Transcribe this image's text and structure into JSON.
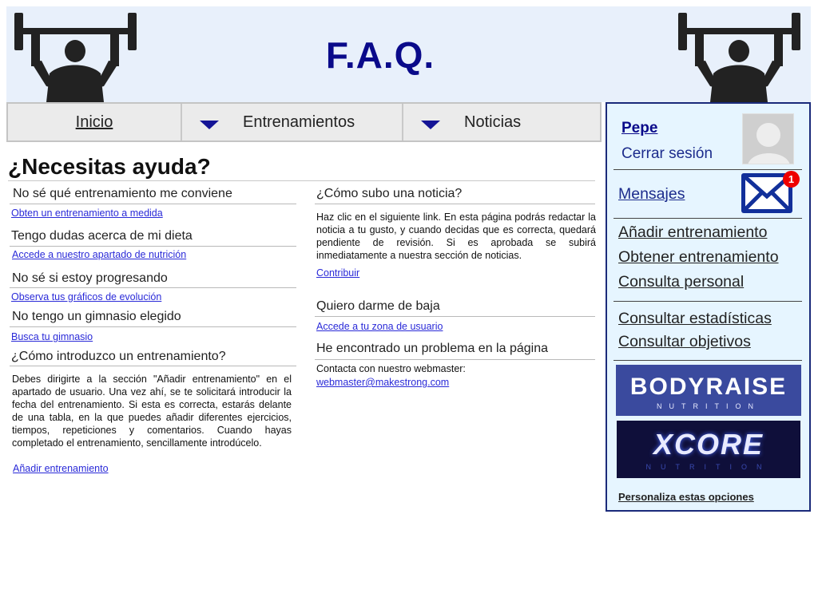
{
  "header": {
    "title": "F.A.Q."
  },
  "nav": {
    "home": "Inicio",
    "training": "Entrenamientos",
    "news": "Noticias"
  },
  "main": {
    "title": "¿Necesitas ayuda?",
    "left": [
      {
        "q": "No sé qué entrenamiento me conviene",
        "link": "Obten un entrenamiento a medida"
      },
      {
        "q": "Tengo dudas acerca de mi dieta",
        "link": "Accede a nuestro apartado de nutrición"
      },
      {
        "q": "No sé si estoy progresando",
        "link": "Observa tus gráficos de evolución"
      },
      {
        "q": "No tengo un gimnasio elegido",
        "link": "Busca tu gimnasio"
      },
      {
        "q": "¿Cómo introduzco un entrenamiento?",
        "text": "Debes dirigirte a la sección \"Añadir entrenamiento\" en el apartado de usuario. Una vez ahí, se te solicitará introducir la fecha del entrenamiento. Si esta es correcta, estarás delante de una tabla, en la que puedes añadir diferentes ejercicios, tiempos, repeticiones y comentarios. Cuando hayas completado el entrenamiento, sencillamente introdúcelo.",
        "link": "Añadir entrenamiento"
      }
    ],
    "right": [
      {
        "q": "¿Cómo subo una noticia?",
        "text": "Haz clic en el siguiente link. En esta página podrás redactar la noticia a tu gusto, y cuando decidas que es correcta, quedará pendiente de revisión. Si es aprobada se subirá inmediatamente a nuestra sección de noticias.",
        "link": "Contribuir"
      },
      {
        "q": "Quiero darme de baja",
        "link": "Accede a tu zona de usuario"
      },
      {
        "q": "He encontrado un problema en la página",
        "text": "Contacta con nuestro webmaster:",
        "link": "webmaster@makestrong.com"
      }
    ]
  },
  "sidebar": {
    "user": "Pepe",
    "logout": "Cerrar sesión",
    "messages": "Mensajes",
    "unread": "1",
    "links": [
      "Añadir entrenamiento",
      "Obtener entrenamiento",
      "Consulta personal",
      "Consultar estadísticas",
      "Consultar objetivos"
    ],
    "banners": [
      {
        "name": "BODYRAISE",
        "sub": "NUTRITION"
      },
      {
        "name": "XCORE",
        "sub": "NUTRITION"
      }
    ],
    "customize": "Personaliza estas opciones"
  }
}
